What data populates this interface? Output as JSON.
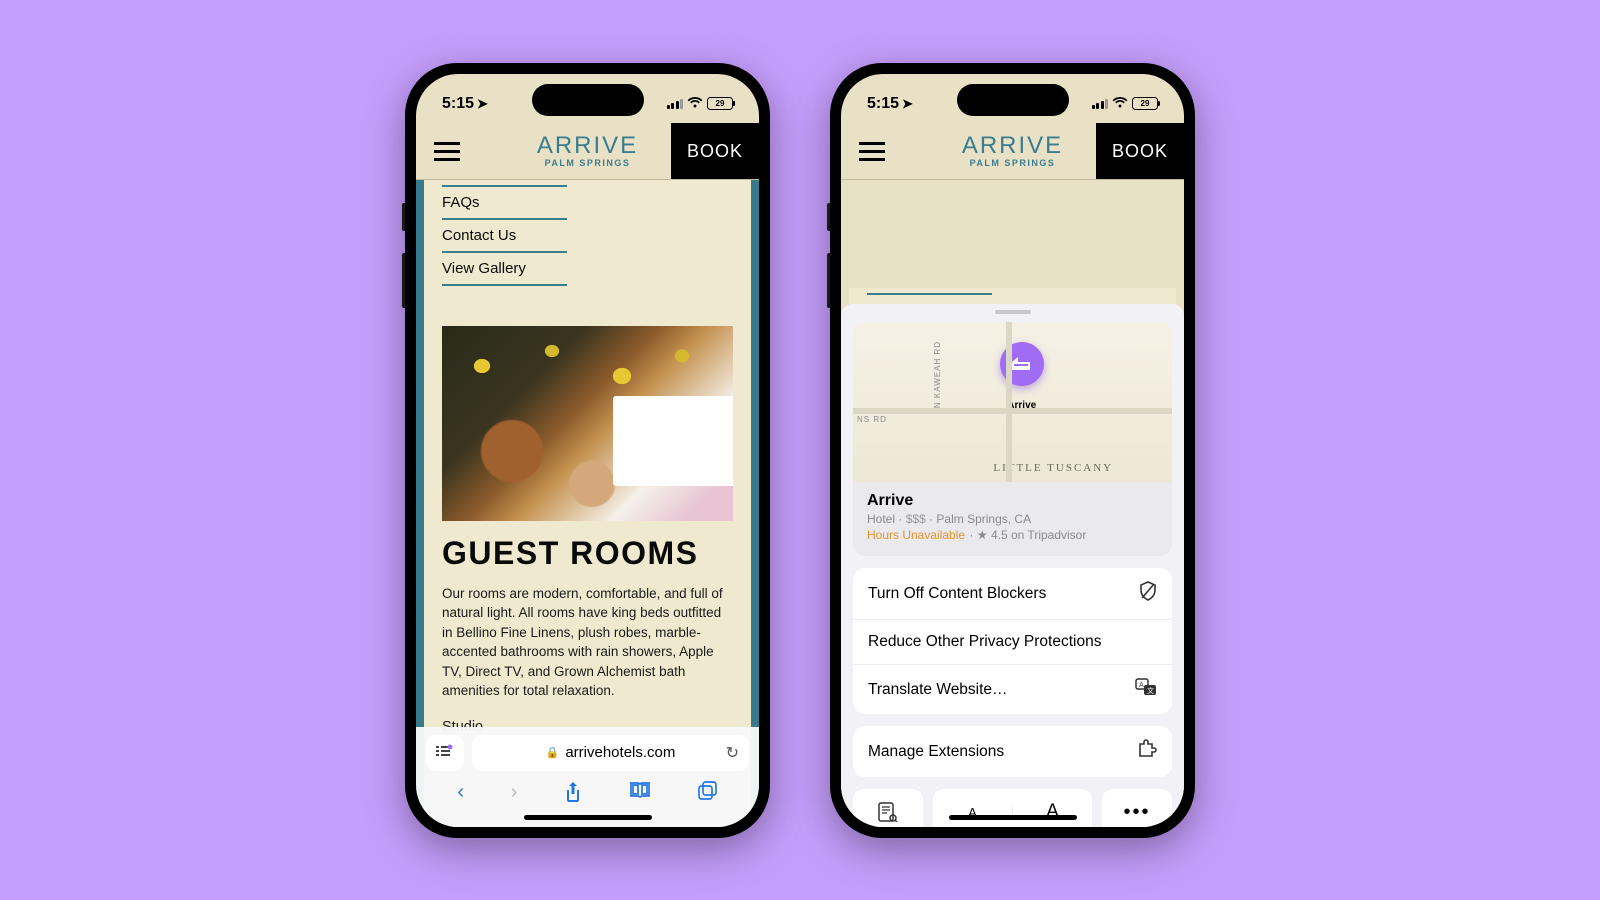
{
  "status": {
    "time": "5:15",
    "battery_pct": "29"
  },
  "brand": {
    "name": "ARRIVE",
    "location": "PALM SPRINGS",
    "accent": "#3b7d8f"
  },
  "book_label": "BOOK",
  "links": [
    "FAQs",
    "Contact Us",
    "View Gallery"
  ],
  "section": {
    "title": "GUEST ROOMS",
    "body": "Our rooms are modern, comfortable, and full of natural light. All rooms have king beds outfitted in Bellino Fine Linens, plush robes, marble-accented bathrooms with rain showers, Apple TV, Direct TV, and Grown Alchemist bath amenities for total relaxation.",
    "room_type": "Studio"
  },
  "safari": {
    "domain": "arrivehotels.com"
  },
  "place": {
    "name": "Arrive",
    "category": "Hotel",
    "price": "$$$",
    "location": "Palm Springs, CA",
    "hours": "Hours Unavailable",
    "rating": "4.5",
    "rating_source": "on Tripadvisor",
    "pin_label": "Arrive",
    "area": "LITTLE TUSCANY",
    "street_v": "N KAWEAH RD",
    "street_h": "NS RD"
  },
  "sheet_menu": {
    "block1": [
      "Turn Off Content Blockers",
      "Reduce Other Privacy Protections",
      "Translate Website…"
    ],
    "block2": [
      "Manage Extensions"
    ]
  }
}
